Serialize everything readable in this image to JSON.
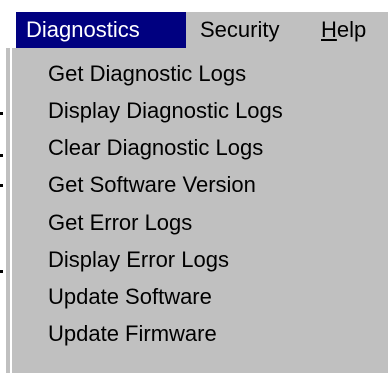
{
  "menubar": {
    "items": [
      {
        "label": "Diagnostics",
        "active": true
      },
      {
        "label": "Security",
        "active": false
      },
      {
        "label_mnemonic": "H",
        "label_rest": "elp",
        "active": false
      }
    ]
  },
  "diagnostics_menu": {
    "items": [
      {
        "label": "Get Diagnostic Logs"
      },
      {
        "label": "Display Diagnostic Logs"
      },
      {
        "label": "Clear Diagnostic Logs"
      },
      {
        "label": "Get Software Version"
      },
      {
        "label": "Get Error Logs"
      },
      {
        "label": "Display Error Logs"
      },
      {
        "label": "Update Software"
      },
      {
        "label": "Update Firmware"
      }
    ]
  },
  "colors": {
    "menu_background": "#c0c0c0",
    "selection_background": "#000080",
    "selection_text": "#ffffff",
    "text": "#000000"
  }
}
